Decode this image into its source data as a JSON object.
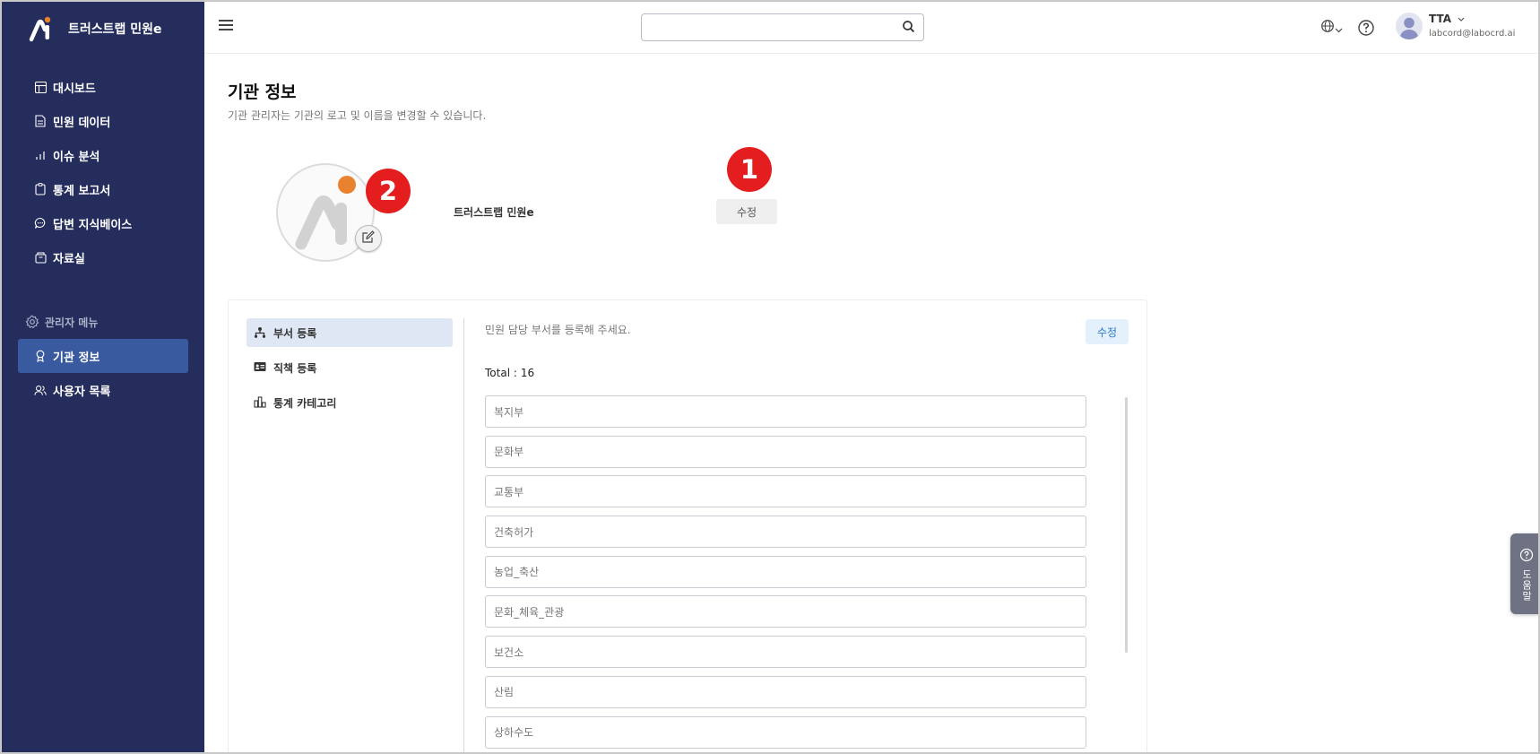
{
  "app": {
    "name": "트러스트랩 민원e"
  },
  "sidebar": {
    "items": [
      {
        "label": "대시보드",
        "icon": "dashboard-icon"
      },
      {
        "label": "민원 데이터",
        "icon": "document-icon"
      },
      {
        "label": "이슈 분석",
        "icon": "bar-chart-icon"
      },
      {
        "label": "통계 보고서",
        "icon": "clipboard-icon"
      },
      {
        "label": "답변 지식베이스",
        "icon": "chat-icon"
      },
      {
        "label": "자료실",
        "icon": "archive-icon"
      }
    ],
    "admin_label": "관리자 메뉴",
    "admin_items": [
      {
        "label": "기관 정보",
        "icon": "badge-icon",
        "active": true
      },
      {
        "label": "사용자 목록",
        "icon": "users-icon"
      }
    ]
  },
  "header": {
    "search_placeholder": "",
    "user": {
      "name": "TTA",
      "email": "labcord@labocrd.ai"
    }
  },
  "main": {
    "title": "기관 정보",
    "subtitle": "기관 관리자는 기관의 로고 및 이름을 변경할 수 있습니다.",
    "org_name": "트러스트랩 민원e",
    "org_edit_label": "수정",
    "badges": [
      "1",
      "2"
    ]
  },
  "settings": {
    "tabs": [
      {
        "label": "부서 등록",
        "icon": "org-chart-icon",
        "active": true
      },
      {
        "label": "직책 등록",
        "icon": "id-card-icon"
      },
      {
        "label": "통계 카테고리",
        "icon": "chart-category-icon"
      }
    ],
    "description": "민원 담당 부서를 등록해 주세요.",
    "edit_label": "수정",
    "total_label": "Total :",
    "total_count": "16",
    "departments": [
      "복지부",
      "문화부",
      "교통부",
      "건축허가",
      "농업_축산",
      "문화_체육_관광",
      "보건소",
      "산림",
      "상하수도"
    ]
  },
  "help_tab": {
    "label": "도움말"
  },
  "colors": {
    "sidebar_bg": "#252d5c",
    "sidebar_active": "#3a5aa0",
    "badge_red": "#e41e1e",
    "accent_orange": "#e8822f"
  }
}
